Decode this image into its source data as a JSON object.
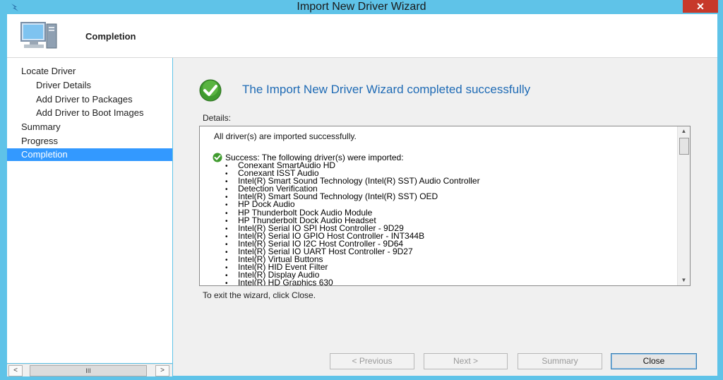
{
  "window": {
    "title": "Import New Driver Wizard",
    "close_glyph": "✕"
  },
  "header": {
    "title": "Completion",
    "icon": "computer-icon"
  },
  "nav": {
    "items": [
      {
        "label": "Locate Driver"
      },
      {
        "label": "Driver Details"
      },
      {
        "label": "Add Driver to Packages"
      },
      {
        "label": "Add Driver to Boot Images"
      },
      {
        "label": "Summary"
      },
      {
        "label": "Progress"
      },
      {
        "label": "Completion"
      }
    ]
  },
  "hscroll": {
    "left": "<",
    "thumb": "III",
    "right": ">"
  },
  "main": {
    "heading": "The Import New Driver Wizard completed successfully",
    "details_label": "Details:",
    "summary_line": "All driver(s) are imported successfully.",
    "success_line": "Success: The following driver(s) were imported:",
    "drivers": [
      "Conexant SmartAudio HD",
      "Conexant ISST Audio",
      "Intel(R) Smart Sound Technology (Intel(R) SST) Audio Controller",
      "Detection Verification",
      "Intel(R) Smart Sound Technology (Intel(R) SST) OED",
      "HP Dock Audio",
      "HP Thunderbolt Dock Audio Module",
      "HP Thunderbolt Dock Audio Headset",
      "Intel(R) Serial IO SPI Host Controller - 9D29",
      "Intel(R) Serial IO GPIO Host Controller - INT344B",
      "Intel(R) Serial IO I2C Host Controller - 9D64",
      "Intel(R) Serial IO UART Host Controller - 9D27",
      "Intel(R) Virtual Buttons",
      "Intel(R) HID Event Filter",
      "Intel(R) Display Audio",
      "Intel(R) HD Graphics 630"
    ],
    "exit_text": "To exit the wizard, click Close."
  },
  "buttons": {
    "previous": "< Previous",
    "next": "Next >",
    "summary": "Summary",
    "close": "Close"
  },
  "colors": {
    "accent": "#3399ff",
    "heading": "#1f6bb5",
    "title_bg": "#5fc3e8"
  }
}
